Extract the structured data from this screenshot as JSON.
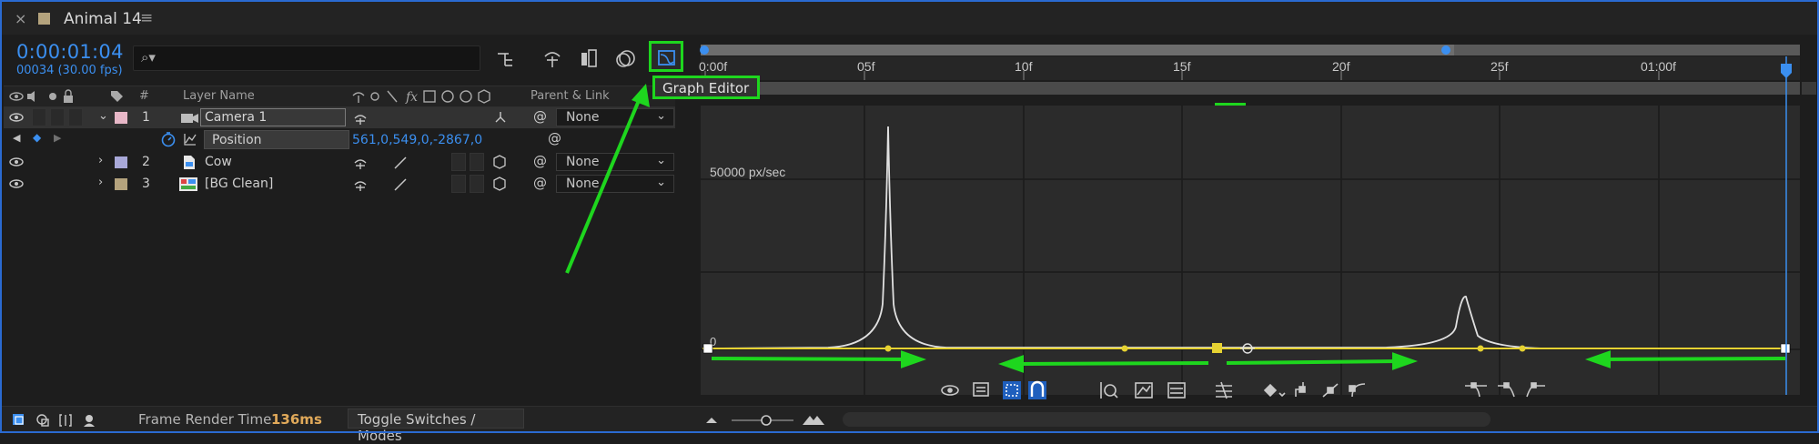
{
  "tab": {
    "close": "×",
    "title": "Animal 14",
    "menu": "≡"
  },
  "panel": {
    "timecode": "0:00:01:04",
    "frames": "00034 (30.00 fps)",
    "search_placeholder": ""
  },
  "columns": {
    "number": "#",
    "layer_name": "Layer Name",
    "parent_link": "Parent & Link",
    "fx": "fx"
  },
  "layers": [
    {
      "num": "1",
      "name": "Camera 1",
      "parent": "None",
      "color": "#e8b8c8"
    },
    {
      "num": "2",
      "name": "Cow",
      "parent": "None",
      "color": "#a8a8d8"
    },
    {
      "num": "3",
      "name": "[BG Clean]",
      "parent": "None",
      "color": "#b4a37d"
    }
  ],
  "position": {
    "label": "Position",
    "value": "561,0,549,0,-2867,0"
  },
  "ruler": {
    "ticks": [
      "0:00f",
      "05f",
      "10f",
      "15f",
      "20f",
      "25f",
      "01:00f"
    ]
  },
  "graph": {
    "speed_label": "50000 px/sec",
    "zero_label": "0"
  },
  "tooltip": "Graph Editor",
  "bottom": {
    "frame_render_label": "Frame Render Time",
    "frame_render_value": "136ms",
    "toggle_label": "Toggle Switches / Modes"
  },
  "colors": {
    "accent_blue": "#3b8ff0",
    "annotation_green": "#1ed61e",
    "curve_yellow": "#e6d232",
    "curve_white": "#e0e0e0"
  }
}
